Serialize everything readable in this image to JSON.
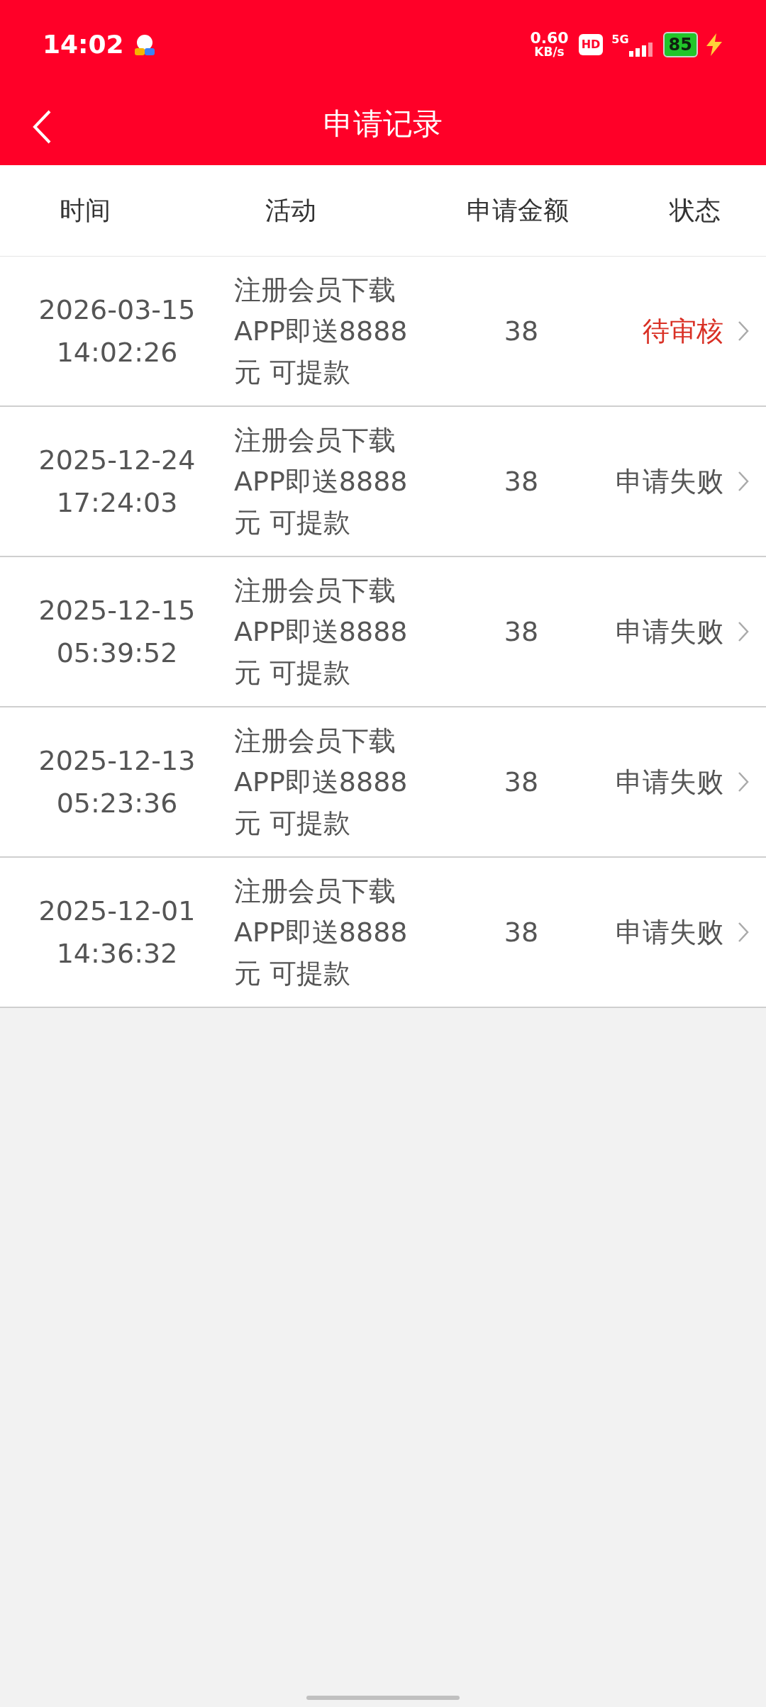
{
  "status_bar": {
    "time": "14:02",
    "speed_value": "0.60",
    "speed_unit": "KB/s",
    "hd": "HD",
    "network": "5G",
    "battery": "85"
  },
  "title_bar": {
    "title": "申请记录"
  },
  "columns": [
    "时间",
    "活动",
    "申请金额",
    "状态"
  ],
  "rows": [
    {
      "date": "2026-03-15",
      "time": "14:02:26",
      "activity": [
        "注册会员下载",
        "APP即送8888",
        "元 可提款"
      ],
      "amount": "38",
      "status": "待审核",
      "kind": "pending"
    },
    {
      "date": "2025-12-24",
      "time": "17:24:03",
      "activity": [
        "注册会员下载",
        "APP即送8888",
        "元 可提款"
      ],
      "amount": "38",
      "status": "申请失败",
      "kind": "failed"
    },
    {
      "date": "2025-12-15",
      "time": "05:39:52",
      "activity": [
        "注册会员下载",
        "APP即送8888",
        "元 可提款"
      ],
      "amount": "38",
      "status": "申请失败",
      "kind": "failed"
    },
    {
      "date": "2025-12-13",
      "time": "05:23:36",
      "activity": [
        "注册会员下载",
        "APP即送8888",
        "元 可提款"
      ],
      "amount": "38",
      "status": "申请失败",
      "kind": "failed"
    },
    {
      "date": "2025-12-01",
      "time": "14:36:32",
      "activity": [
        "注册会员下载",
        "APP即送8888",
        "元 可提款"
      ],
      "amount": "38",
      "status": "申请失败",
      "kind": "failed"
    }
  ]
}
